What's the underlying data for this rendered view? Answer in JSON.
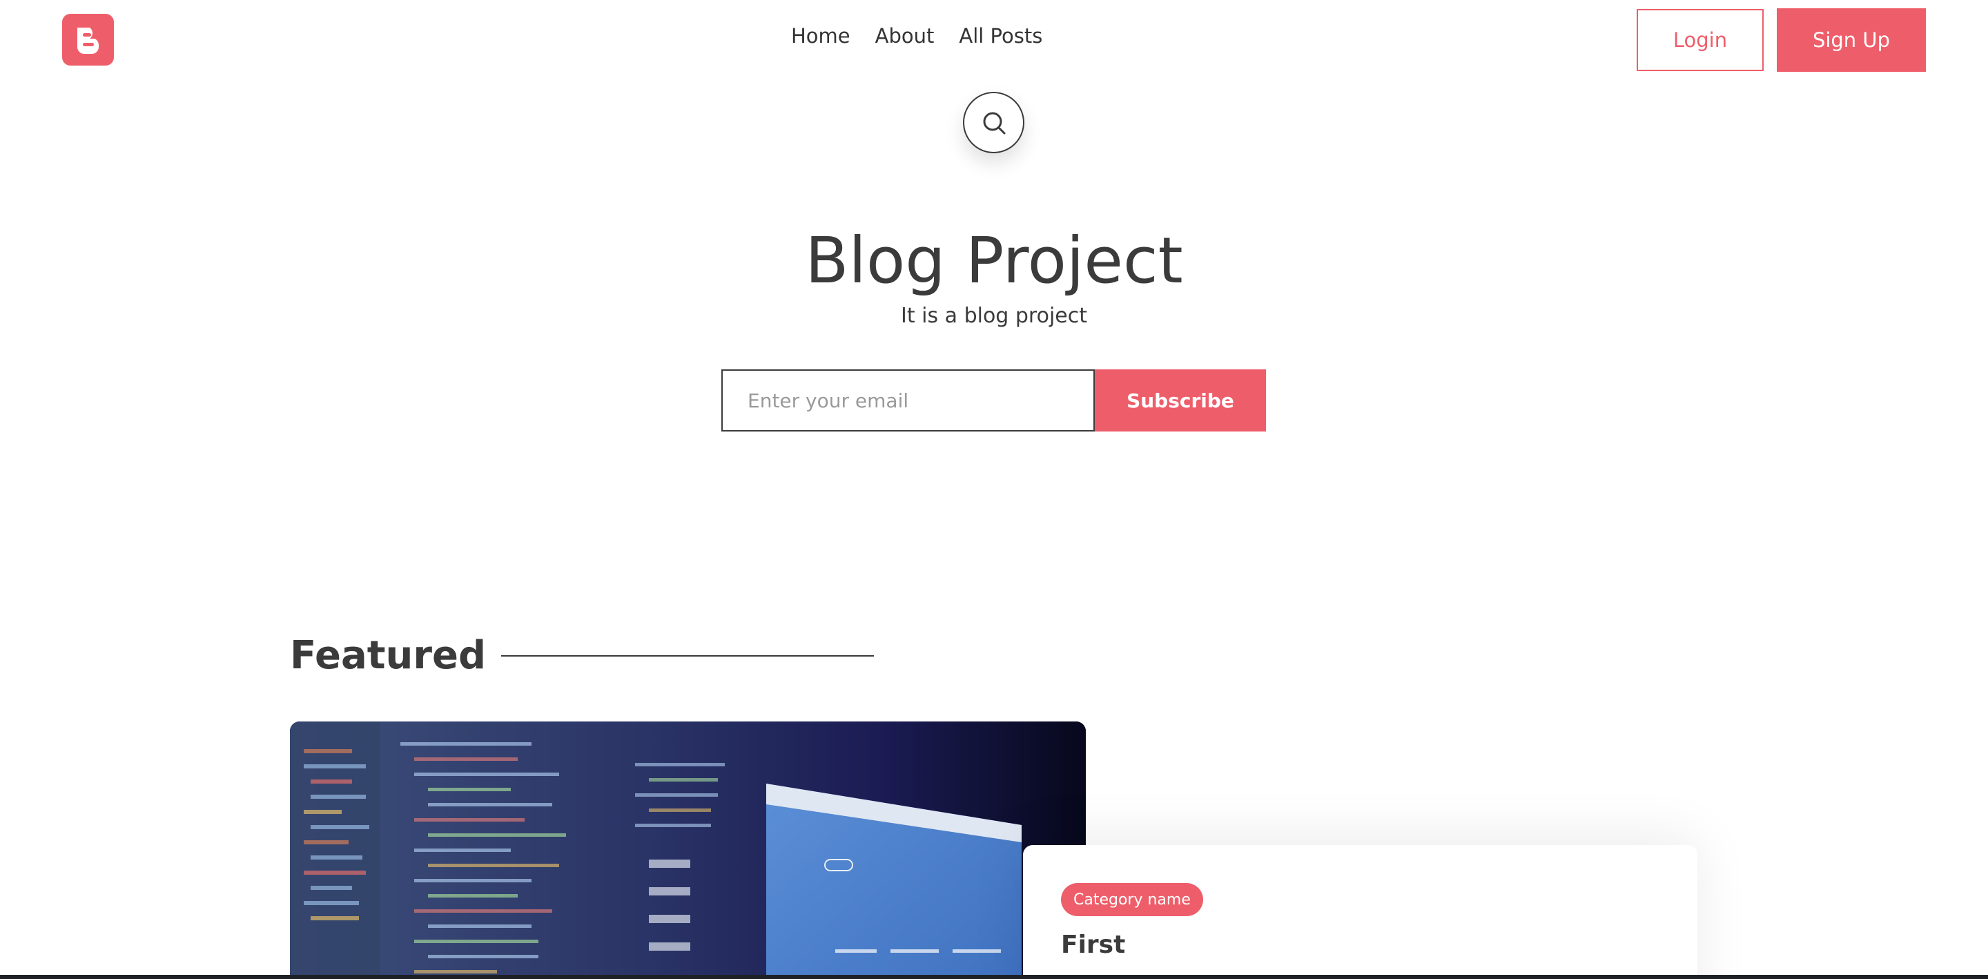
{
  "header": {
    "logo_icon": "blogger-icon",
    "nav": [
      {
        "label": "Home"
      },
      {
        "label": "About"
      },
      {
        "label": "All Posts"
      }
    ],
    "login_label": "Login",
    "signup_label": "Sign Up"
  },
  "search": {
    "icon": "search-icon"
  },
  "hero": {
    "title": "Blog Project",
    "subtitle": "It is a blog project",
    "email_placeholder": "Enter your email",
    "email_value": "",
    "subscribe_label": "Subscribe"
  },
  "featured": {
    "heading": "Featured",
    "post": {
      "category": "Category name",
      "title": "First"
    }
  },
  "colors": {
    "accent": "#ee5e6a",
    "text": "#3b3b3b",
    "background": "#ffffff"
  }
}
